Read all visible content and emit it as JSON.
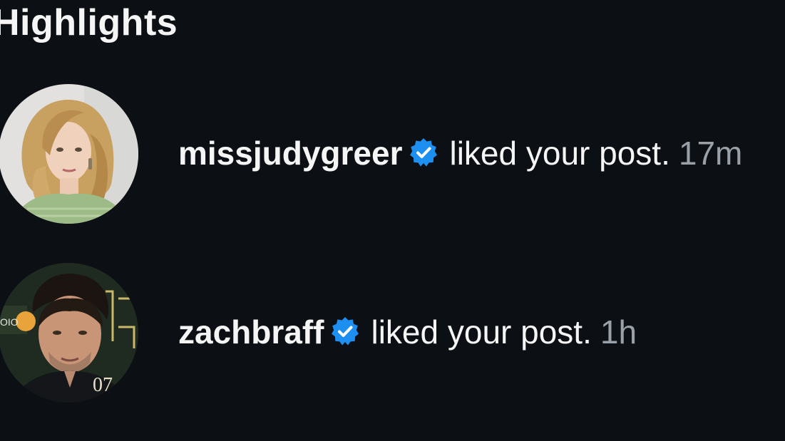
{
  "section": {
    "title": "Highlights"
  },
  "notifications": [
    {
      "username": "missjudygreer",
      "verified": true,
      "action": "liked your post.",
      "time": "17m",
      "avatar": "profile-photo"
    },
    {
      "username": "zachbraff",
      "verified": true,
      "action": "liked your post.",
      "time": "1h",
      "avatar": "profile-photo"
    }
  ],
  "colors": {
    "background": "#0c0f14",
    "text": "#f5f5f5",
    "muted": "#9aa0a8",
    "verified_badge": "#1d8ff0"
  }
}
